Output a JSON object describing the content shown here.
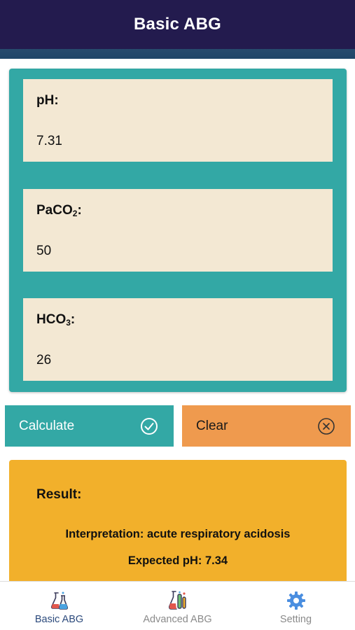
{
  "header": {
    "title": "Basic ABG"
  },
  "fields": [
    {
      "label_main": "pH:",
      "label_sub": "",
      "label_tail": "",
      "value": "7.31"
    },
    {
      "label_main": "PaCO",
      "label_sub": "2",
      "label_tail": ":",
      "value": "50"
    },
    {
      "label_main": "HCO",
      "label_sub": "3",
      "label_tail": ":",
      "value": "26"
    }
  ],
  "buttons": {
    "calculate": {
      "label": "Calculate",
      "icon": "check-circle-icon"
    },
    "clear": {
      "label": "Clear",
      "icon": "x-circle-icon"
    }
  },
  "result": {
    "title": "Result:",
    "interpretation": "Interpretation: acute respiratory acidosis",
    "expected": "Expected pH: 7.34"
  },
  "tabs": [
    {
      "label": "Basic ABG",
      "icon": "flask-icon",
      "active": true
    },
    {
      "label": "Advanced ABG",
      "icon": "lab-flasks-icon",
      "active": false
    },
    {
      "label": "Setting",
      "icon": "gear-icon",
      "active": false
    }
  ],
  "colors": {
    "header": "#231b4e",
    "teal": "#33a8a5",
    "field_bg": "#f3e8d3",
    "clear": "#ef9a4e",
    "result_bg": "#f2b02b"
  }
}
